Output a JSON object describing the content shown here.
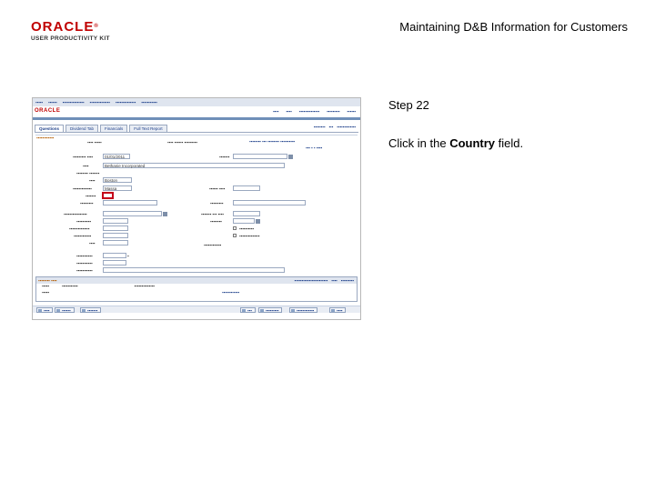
{
  "header": {
    "logo_word": "ORACLE",
    "logo_reg": "®",
    "logo_sub": "USER PRODUCTIVITY KIT",
    "title": "Maintaining D&B Information for Customers"
  },
  "step": {
    "label": "Step 22",
    "instruction_before": "Click in the ",
    "instruction_bold": "Country",
    "instruction_after": " field."
  },
  "screenshot": {
    "brand": "ORACLE",
    "tabs": [
      "Questions",
      "Dividend Tab",
      "Financials",
      "Full Text Report"
    ],
    "fields": {
      "effective_date": "01/01/2011",
      "name": "Bethanie Incorporated",
      "city": "Boston",
      "state": "Massa"
    }
  },
  "colors": {
    "oracle_red": "#c00000",
    "highlight": "#c4001a",
    "nav_bg": "#dfe5ef",
    "link": "#1d3f8a"
  }
}
